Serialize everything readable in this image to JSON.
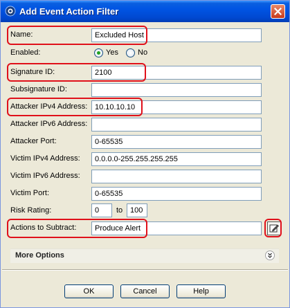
{
  "window": {
    "title": "Add Event Action Filter"
  },
  "form": {
    "name": {
      "label": "Name:",
      "value": "Excluded Host"
    },
    "enabled": {
      "label": "Enabled:",
      "yes_label": "Yes",
      "no_label": "No",
      "selected": "Yes"
    },
    "signature_id": {
      "label": "Signature ID:",
      "value": "2100"
    },
    "subsignature_id": {
      "label": "Subsignature ID:",
      "value": ""
    },
    "attacker_ipv4": {
      "label": "Attacker IPv4 Address:",
      "value": "10.10.10.10"
    },
    "attacker_ipv6": {
      "label": "Attacker IPv6 Address:",
      "value": ""
    },
    "attacker_port": {
      "label": "Attacker Port:",
      "value": "0-65535"
    },
    "victim_ipv4": {
      "label": "Victim IPv4 Address:",
      "value": "0.0.0.0-255.255.255.255"
    },
    "victim_ipv6": {
      "label": "Victim IPv6 Address:",
      "value": ""
    },
    "victim_port": {
      "label": "Victim Port:",
      "value": "0-65535"
    },
    "risk_rating": {
      "label": "Risk Rating:",
      "from": "0",
      "to_label": "to",
      "to": "100"
    },
    "actions": {
      "label": "Actions to Subtract:",
      "value": "Produce Alert"
    }
  },
  "more_options": {
    "label": "More Options"
  },
  "buttons": {
    "ok": "OK",
    "cancel": "Cancel",
    "help": "Help"
  },
  "colors": {
    "highlight": "#e0101a",
    "titlebar": "#0054e3"
  }
}
